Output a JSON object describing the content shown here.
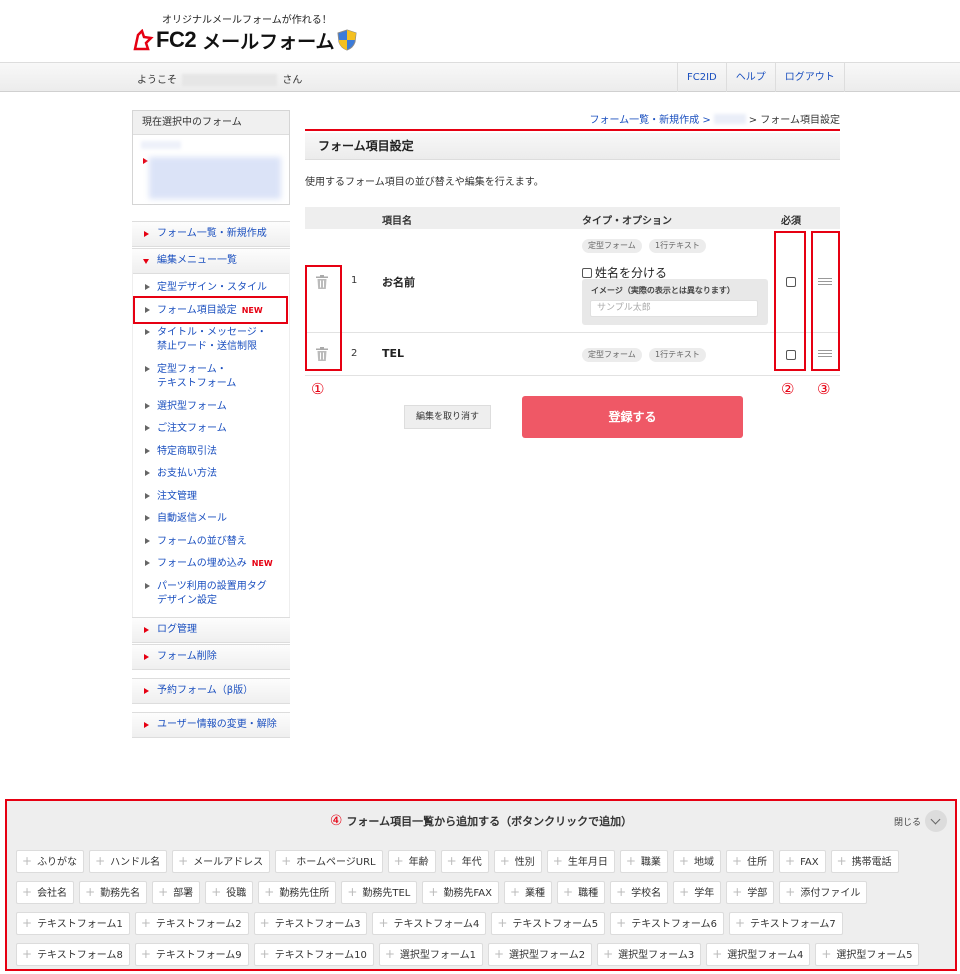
{
  "header": {
    "tagline": "オリジナルメールフォームが作れる！",
    "logo_fc2": "FC2",
    "logo_text": "メールフォーム"
  },
  "topbar": {
    "welcome_prefix": "ようこそ",
    "welcome_suffix": "さん",
    "links": [
      "FC2ID",
      "ヘルプ",
      "ログアウト"
    ]
  },
  "sidebar": {
    "current_form_label": "現在選択中のフォーム",
    "main_items": {
      "list": "フォーム一覧・新規作成",
      "edit_menu": "編集メニュー一覧",
      "log": "ログ管理",
      "delete": "フォーム削除",
      "reserve": "予約フォーム（β版）",
      "user": "ユーザー情報の変更・解除"
    },
    "sub_items": [
      {
        "label": "定型デザイン・スタイル",
        "new": ""
      },
      {
        "label": "フォーム項目設定",
        "new": "NEW"
      },
      {
        "label": "タイトル・メッセージ・",
        "label2": "禁止ワード・送信制限",
        "new": ""
      },
      {
        "label": "定型フォーム・",
        "label2": "テキストフォーム",
        "new": ""
      },
      {
        "label": "選択型フォーム",
        "new": ""
      },
      {
        "label": "ご注文フォーム",
        "new": ""
      },
      {
        "label": "特定商取引法",
        "new": ""
      },
      {
        "label": "お支払い方法",
        "new": ""
      },
      {
        "label": "注文管理",
        "new": ""
      },
      {
        "label": "自動返信メール",
        "new": ""
      },
      {
        "label": "フォームの並び替え",
        "new": ""
      },
      {
        "label": "フォームの埋め込み",
        "new": "NEW"
      },
      {
        "label": "パーツ利用の設置用タグ",
        "label2": "デザイン設定",
        "new": ""
      }
    ]
  },
  "breadcrumb": {
    "link": "フォーム一覧・新規作成 >",
    "current": "> フォーム項目設定"
  },
  "main": {
    "title": "フォーム項目設定",
    "description": "使用するフォーム項目の並び替えや編集を行えます。",
    "columns": {
      "name": "項目名",
      "type": "タイプ・オプション",
      "required": "必須"
    },
    "rows": [
      {
        "num": "1",
        "name": "お名前",
        "tags": [
          "定型フォーム",
          "1行テキスト"
        ],
        "split_label": "姓名を分ける",
        "preview_label": "イメージ（実際の表示とは異なります）",
        "preview_placeholder": "サンプル太郎"
      },
      {
        "num": "2",
        "name": "TEL",
        "tags": [
          "定型フォーム",
          "1行テキスト"
        ]
      }
    ],
    "markers": [
      "①",
      "②",
      "③"
    ],
    "cancel_label": "編集を取り消す",
    "save_label": "登録する"
  },
  "panel": {
    "marker": "④",
    "title": "フォーム項目一覧から追加する（ボタンクリックで追加）",
    "close_label": "閉じる",
    "chip_rows": [
      [
        "ふりがな",
        "ハンドル名",
        "メールアドレス",
        "ホームページURL",
        "年齢",
        "年代",
        "性別",
        "生年月日",
        "職業",
        "地域",
        "住所",
        "FAX",
        "携帯電話"
      ],
      [
        "会社名",
        "勤務先名",
        "部署",
        "役職",
        "勤務先住所",
        "勤務先TEL",
        "勤務先FAX",
        "業種",
        "職種",
        "学校名",
        "学年",
        "学部",
        "添付ファイル"
      ],
      [
        "テキストフォーム1",
        "テキストフォーム2",
        "テキストフォーム3",
        "テキストフォーム4",
        "テキストフォーム5",
        "テキストフォーム6",
        "テキストフォーム7"
      ],
      [
        "テキストフォーム8",
        "テキストフォーム9",
        "テキストフォーム10",
        "選択型フォーム1",
        "選択型フォーム2",
        "選択型フォーム3",
        "選択型フォーム4",
        "選択型フォーム5"
      ]
    ]
  },
  "colors": {
    "accent": "#e60012",
    "link": "#1a4fbf",
    "save": "#ef5866"
  }
}
